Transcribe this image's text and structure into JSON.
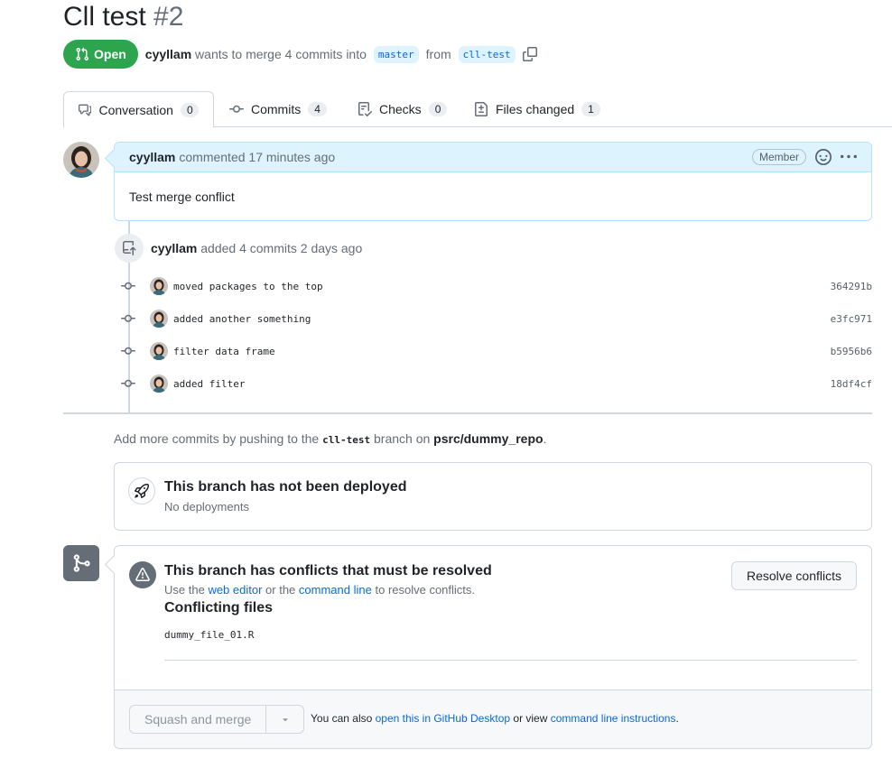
{
  "pr": {
    "title": "Cll test",
    "number": "#2",
    "state_label": "Open",
    "author": "cyyllam",
    "merge_text": "wants to merge 4 commits into",
    "base_branch": "master",
    "from_text": "from",
    "head_branch": "cll-test"
  },
  "tabs": [
    {
      "label": "Conversation",
      "count": "0"
    },
    {
      "label": "Commits",
      "count": "4"
    },
    {
      "label": "Checks",
      "count": "0"
    },
    {
      "label": "Files changed",
      "count": "1"
    }
  ],
  "comment": {
    "author": "cyyllam",
    "action": "commented",
    "time": "17 minutes ago",
    "role": "Member",
    "body": "Test merge conflict"
  },
  "commits_event": {
    "author": "cyyllam",
    "text": "added 4 commits 2 days ago",
    "commits": [
      {
        "message": "moved packages to the top",
        "sha": "364291b"
      },
      {
        "message": "added another something",
        "sha": "e3fc971"
      },
      {
        "message": "filter data frame",
        "sha": "b5956b6"
      },
      {
        "message": "added filter",
        "sha": "18df4cf"
      }
    ]
  },
  "push_hint": {
    "prefix": "Add more commits by pushing to the",
    "branch": "cll-test",
    "middle": "branch on",
    "repo": "psrc/dummy_repo",
    "suffix": "."
  },
  "deploy": {
    "title": "This branch has not been deployed",
    "subtitle": "No deployments"
  },
  "merge": {
    "conflict_title": "This branch has conflicts that must be resolved",
    "use_the": "Use the",
    "web_editor": "web editor",
    "or_the": "or the",
    "command_line": "command line",
    "to_resolve": "to resolve conflicts.",
    "resolve_button": "Resolve conflicts",
    "conflicting_files_title": "Conflicting files",
    "conflicting_file": "dummy_file_01.R",
    "squash_button": "Squash and merge",
    "footer_prefix": "You can also",
    "footer_link1": "open this in GitHub Desktop",
    "footer_middle": "or view",
    "footer_link2": "command line instructions",
    "footer_suffix": "."
  },
  "colors": {
    "open_green": "#2da44e",
    "link_blue": "#0969da",
    "header_blue": "#ddf4ff"
  }
}
